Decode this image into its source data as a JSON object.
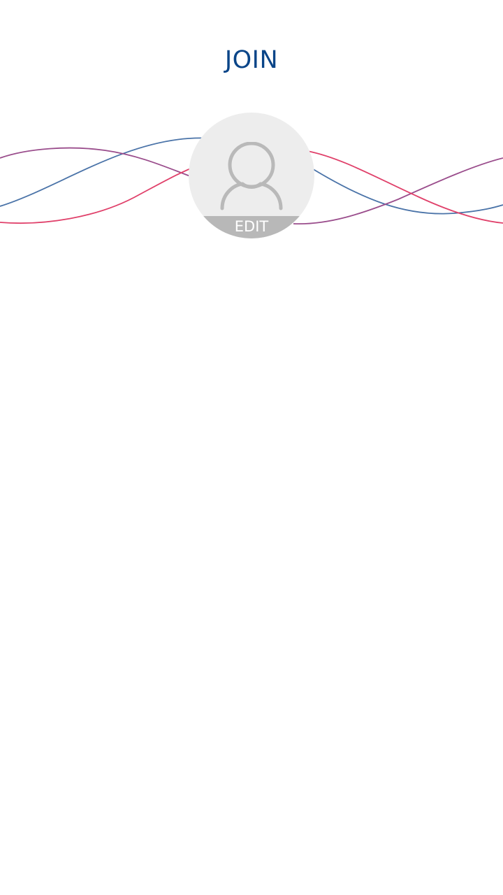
{
  "header": {
    "title": "JOIN"
  },
  "profile": {
    "avatar_icon": "user-silhouette-icon",
    "edit_label": "EDIT"
  },
  "theme": {
    "title_color": "#0a4588",
    "avatar_background": "#ededed",
    "edit_strip_color": "#b8b8b8",
    "wave_colors": [
      "#4a73a8",
      "#9a4d8c",
      "#e0406a"
    ]
  }
}
